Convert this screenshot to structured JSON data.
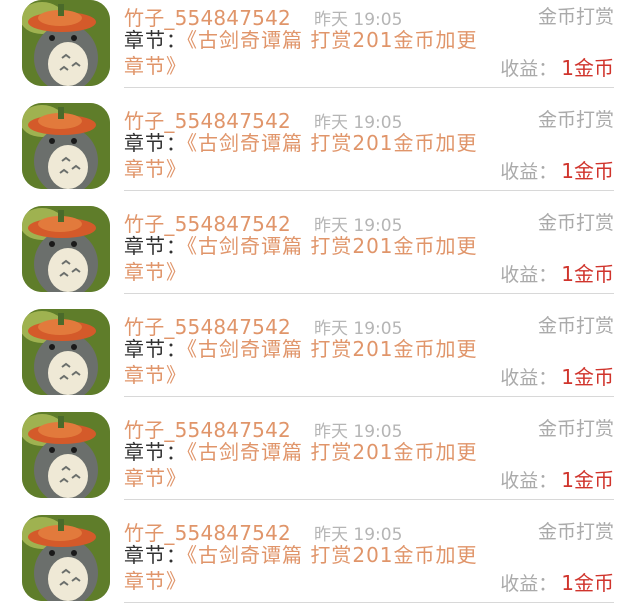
{
  "items": [
    {
      "name": "竹子_554847542",
      "time": "昨天 19:05",
      "type": "金币打赏",
      "chapter_label": "章节：",
      "chapter": "《古剑奇谭篇 打赏201金币加更章节》",
      "earn_label": "收益：",
      "earn_value": "1金币"
    },
    {
      "name": "竹子_554847542",
      "time": "昨天 19:05",
      "type": "金币打赏",
      "chapter_label": "章节：",
      "chapter": "《古剑奇谭篇 打赏201金币加更章节》",
      "earn_label": "收益：",
      "earn_value": "1金币"
    },
    {
      "name": "竹子_554847542",
      "time": "昨天 19:05",
      "type": "金币打赏",
      "chapter_label": "章节：",
      "chapter": "《古剑奇谭篇 打赏201金币加更章节》",
      "earn_label": "收益：",
      "earn_value": "1金币"
    },
    {
      "name": "竹子_554847542",
      "time": "昨天 19:05",
      "type": "金币打赏",
      "chapter_label": "章节：",
      "chapter": "《古剑奇谭篇 打赏201金币加更章节》",
      "earn_label": "收益：",
      "earn_value": "1金币"
    },
    {
      "name": "竹子_554847542",
      "time": "昨天 19:05",
      "type": "金币打赏",
      "chapter_label": "章节：",
      "chapter": "《古剑奇谭篇 打赏201金币加更章节》",
      "earn_label": "收益：",
      "earn_value": "1金币"
    },
    {
      "name": "竹子_554847542",
      "time": "昨天 19:05",
      "type": "金币打赏",
      "chapter_label": "章节：",
      "chapter": "《古剑奇谭篇 打赏201金币加更章节》",
      "earn_label": "收益：",
      "earn_value": "1金币"
    }
  ],
  "colors": {
    "name": "#e0956a",
    "time": "#b5b5b5",
    "muted": "#aaaaaa",
    "amount": "#d0342c",
    "divider": "#d8d8d8"
  },
  "avatar_icon": "totoro-figure-icon"
}
